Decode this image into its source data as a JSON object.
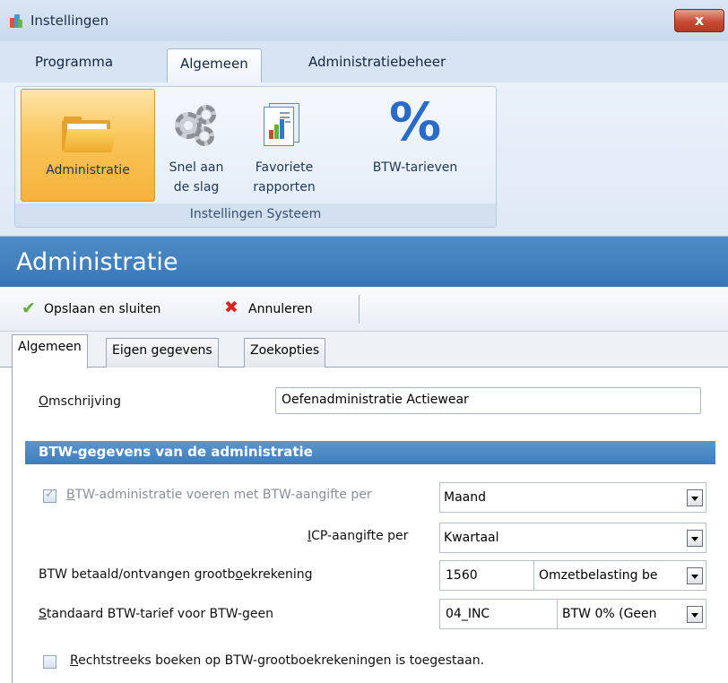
{
  "window": {
    "title": "Instellingen",
    "close_symbol": "x"
  },
  "ribbon": {
    "tabs": [
      "Programma",
      "Algemeen",
      "Administratiebeheer"
    ],
    "buttons": [
      {
        "label1": "Administratie",
        "label2": ""
      },
      {
        "label1": "Snel aan",
        "label2": "de slag"
      },
      {
        "label1": "Favoriete",
        "label2": "rapporten"
      },
      {
        "label1": "BTW-tarieven",
        "label2": ""
      }
    ],
    "percent_glyph": "%",
    "group_label": "Instellingen Systeem"
  },
  "heading": "Administratie",
  "toolbar": {
    "save_label": "Opslaan en sluiten",
    "cancel_label": "Annuleren"
  },
  "subtabs": [
    "Algemeen",
    "Eigen gegevens",
    "Zoekopties"
  ],
  "form": {
    "omschrijving_first": "O",
    "omschrijving_rest": "mschrijving",
    "omschrijving_value": "Oefenadministratie Actiewear",
    "section_title": "BTW-gegevens van de administratie",
    "btw_admin_first": "B",
    "btw_admin_rest": "TW-administratie voeren met BTW-aangifte per",
    "btw_admin_value": "Maand",
    "icp_first": "I",
    "icp_rest": "CP-aangifte per",
    "icp_value": "Kwartaal",
    "grootboek_pre": "BTW betaald/ontvangen grootb",
    "grootboek_ul": "o",
    "grootboek_post": "ekrekening",
    "grootboek_code": "1560",
    "grootboek_desc": "Omzetbelasting be",
    "standaard_first": "S",
    "standaard_rest": "tandaard BTW-tarief voor BTW-geen",
    "standaard_code": "04_INC",
    "standaard_desc": "BTW 0% (Geen",
    "rechtstreeks_first": "R",
    "rechtstreeks_rest": "echtstreeks boeken op BTW-grootboekrekeningen is toegestaan."
  }
}
